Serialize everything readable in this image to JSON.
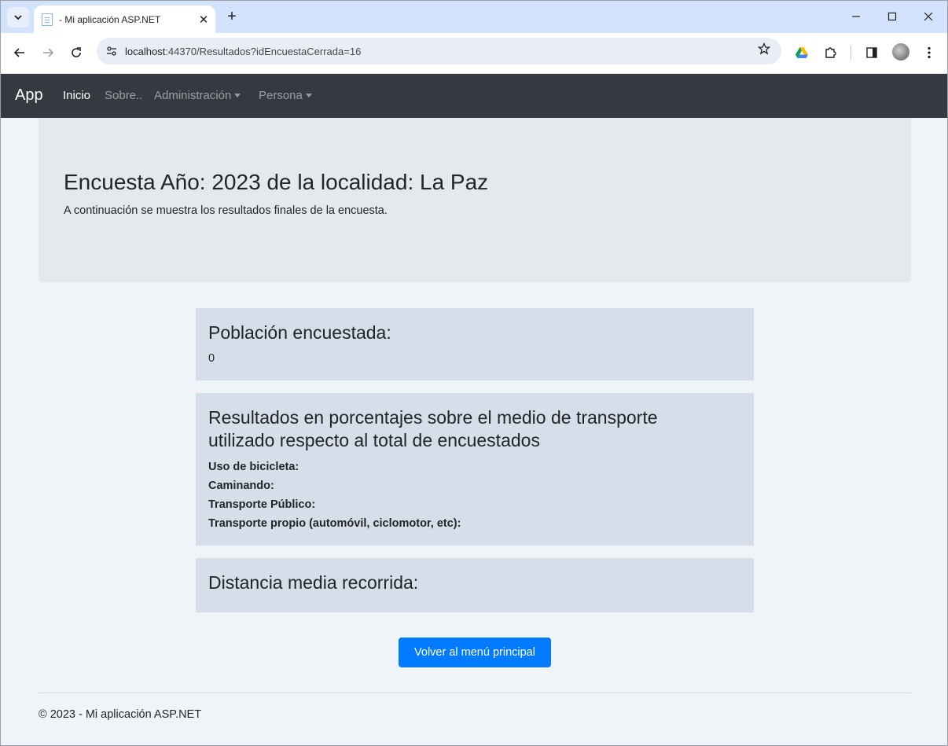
{
  "browser": {
    "tab_title": "- Mi aplicación ASP.NET",
    "url_host": "localhost",
    "url_rest": ":44370/Resultados?idEncuestaCerrada=16",
    "new_tab_symbol": "+",
    "close_symbol": "✕",
    "minimize_symbol": "—",
    "maximize_symbol": "☐"
  },
  "navbar": {
    "brand": "App",
    "links": [
      {
        "label": "Inicio",
        "active": true
      },
      {
        "label": "Sobre..",
        "active": false
      },
      {
        "label": "Administración",
        "dropdown": true
      },
      {
        "label": "Persona",
        "dropdown": true
      }
    ]
  },
  "jumbotron": {
    "title": "Encuesta Año: 2023 de la localidad: La Paz",
    "lead": "A continuación se muestra los resultados finales de la encuesta."
  },
  "cards": {
    "poblacion": {
      "heading": "Población encuestada:",
      "value": "0"
    },
    "transporte": {
      "heading_line1": "Resultados en porcentajes sobre el medio de transporte",
      "heading_line2": "utilizado respecto al total de encuestados",
      "items": [
        "Uso de bicicleta:",
        "Caminando:",
        "Transporte Público:",
        "Transporte propio (automóvil, ciclomotor, etc):"
      ]
    },
    "distancia": {
      "heading": "Distancia media recorrida:"
    }
  },
  "actions": {
    "back_button": "Volver al menú principal"
  },
  "footer": {
    "text": "© 2023 - Mi aplicación ASP.NET"
  },
  "colors": {
    "navbar_bg": "#343a40",
    "primary": "#007bff",
    "card_bg": "#d6dfe9",
    "jumbotron_bg": "#e6e9ec"
  }
}
